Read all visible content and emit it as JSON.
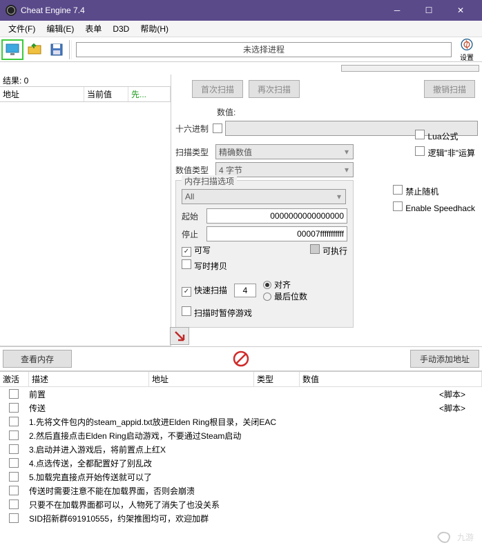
{
  "title": "Cheat Engine 7.4",
  "menu": [
    "文件(F)",
    "编辑(E)",
    "表单",
    "D3D",
    "帮助(H)"
  ],
  "process": "未选择进程",
  "settingsLabel": "设置",
  "resultLabel": "结果: 0",
  "columns": {
    "addr": "地址",
    "cur": "当前值",
    "prev": "先..."
  },
  "buttons": {
    "first": "首次扫描",
    "next": "再次扫描",
    "undo": "撤销扫描",
    "viewmem": "查看内存",
    "addmanual": "手动添加地址"
  },
  "labels": {
    "value": "数值:",
    "hex": "十六进制",
    "scanType": "扫描类型",
    "valueType": "数值类型",
    "exact": "精确数值",
    "bytes4": "4 字节",
    "lua": "Lua公式",
    "notop": "逻辑\"非\"运算",
    "memopt": "内存扫描选项",
    "all": "All",
    "start": "起始",
    "stop": "停止",
    "startVal": "0000000000000000",
    "stopVal": "00007fffffffffff",
    "writable": "可写",
    "executable": "可执行",
    "cow": "写时拷贝",
    "norandom": "禁止随机",
    "speedhack": "Enable Speedhack",
    "fastscan": "快速扫描",
    "fastval": "4",
    "align": "对齐",
    "lastdigits": "最后位数",
    "pause": "扫描时暂停游戏"
  },
  "cheatCols": {
    "act": "激活",
    "desc": "描述",
    "addr": "地址",
    "type": "类型",
    "val": "数值"
  },
  "cheatRows": [
    {
      "desc": "前置",
      "val": "<脚本>"
    },
    {
      "desc": "传送",
      "val": "<脚本>"
    },
    {
      "desc": "1.先将文件包内的steam_appid.txt放进Elden Ring根目录，关闭EAC",
      "val": ""
    },
    {
      "desc": "2.然后直接点击Elden Ring启动游戏，不要通过Steam启动",
      "val": ""
    },
    {
      "desc": "3.启动并进入游戏后，将前置点上红X",
      "val": ""
    },
    {
      "desc": "4.点选传送，全都配置好了别乱改",
      "val": ""
    },
    {
      "desc": "5.加载完直接点开始传送就可以了",
      "val": ""
    },
    {
      "desc": "传送时需要注意不能在加载界面，否则会崩溃",
      "val": ""
    },
    {
      "desc": "只要不在加载界面都可以，人物死了消失了也没关系",
      "val": ""
    },
    {
      "desc": "SID招新群691910555，约架推图均可，欢迎加群",
      "val": ""
    }
  ],
  "watermark": "九游"
}
